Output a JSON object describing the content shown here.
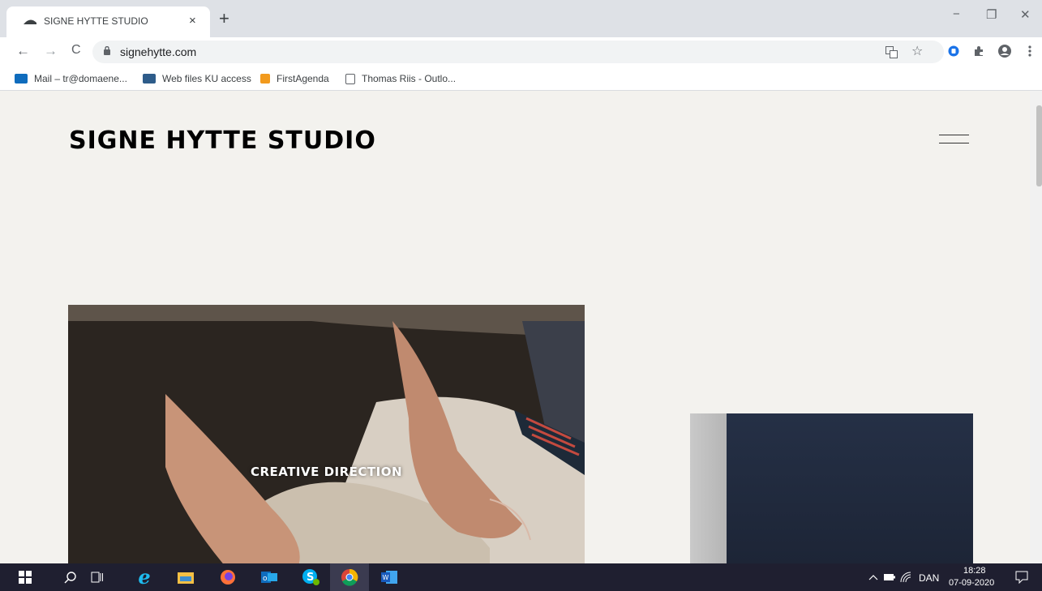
{
  "browser": {
    "tab_title": "SIGNE HYTTE STUDIO",
    "tab_close": "×",
    "new_tab": "+",
    "url": "signehytte.com",
    "window_controls": {
      "minimize": "−",
      "restore": "❐",
      "close": "✕"
    },
    "nav": {
      "back": "←",
      "forward": "→",
      "reload": "C"
    },
    "icons": [
      "translate-icon",
      "star-icon",
      "extension-icon",
      "puzzle-icon",
      "profile-icon",
      "menu-icon"
    ]
  },
  "bookmarks": [
    {
      "label": "Mail – tr@domaene...",
      "icon": "outlook-icon",
      "color": "#0f6cbd"
    },
    {
      "label": "Web files KU access",
      "icon": "web-files-icon",
      "color": "#2e5c8a"
    },
    {
      "label": "FirstAgenda",
      "icon": "firstagenda-icon",
      "color": "#f29a1d"
    },
    {
      "label": "Thomas Riis - Outlo...",
      "icon": "document-icon",
      "color": "#5f6368"
    }
  ],
  "site": {
    "title": "SIGNE HYTTE STUDIO",
    "hero_caption": "CREATIVE DIRECTION"
  },
  "taskbar": {
    "apps": [
      "windows-start-icon",
      "search-icon",
      "task-view-icon",
      "internet-explorer-icon",
      "file-explorer-icon",
      "firefox-icon",
      "outlook-icon",
      "skype-icon",
      "chrome-icon",
      "word-icon"
    ],
    "language": "DAN",
    "time": "18:28",
    "date": "07-09-2020"
  },
  "colors": {
    "page_background": "#f3f2ee",
    "taskbar": "#1f1f30",
    "tabstrip": "#dee1e6"
  }
}
